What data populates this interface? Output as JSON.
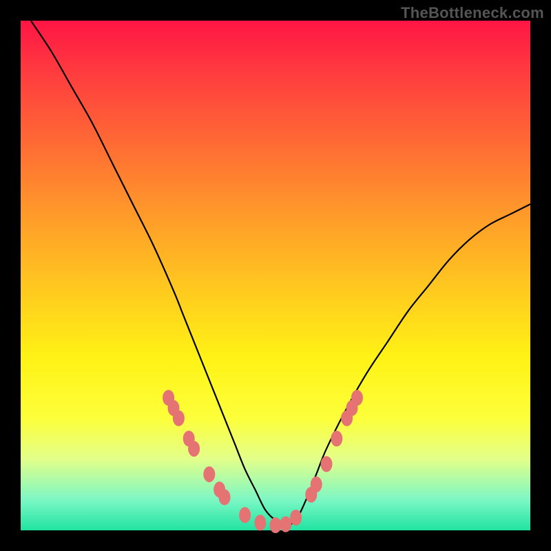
{
  "watermark": "TheBottleneck.com",
  "chart_data": {
    "type": "line",
    "title": "",
    "xlabel": "",
    "ylabel": "",
    "xlim": [
      0,
      100
    ],
    "ylim": [
      0,
      100
    ],
    "series": [
      {
        "name": "curve",
        "x": [
          2,
          6,
          10,
          14,
          18,
          22,
          26,
          30,
          32,
          34,
          36,
          38,
          40,
          42,
          44,
          46,
          48,
          50,
          52,
          54,
          56,
          58,
          60,
          64,
          68,
          72,
          76,
          80,
          84,
          88,
          92,
          96,
          100
        ],
        "y": [
          100,
          94,
          87,
          80,
          72,
          64,
          56,
          47,
          42,
          37,
          32,
          27,
          22,
          17,
          12,
          8,
          4,
          2,
          1,
          2,
          6,
          11,
          16,
          24,
          31,
          37,
          43,
          48,
          53,
          57,
          60,
          62,
          64
        ]
      }
    ],
    "markers": [
      {
        "x": 29,
        "y": 26
      },
      {
        "x": 30,
        "y": 24
      },
      {
        "x": 31,
        "y": 22
      },
      {
        "x": 33,
        "y": 18
      },
      {
        "x": 34,
        "y": 16
      },
      {
        "x": 37,
        "y": 11
      },
      {
        "x": 39,
        "y": 8
      },
      {
        "x": 40,
        "y": 6.5
      },
      {
        "x": 44,
        "y": 3
      },
      {
        "x": 47,
        "y": 1.5
      },
      {
        "x": 50,
        "y": 1
      },
      {
        "x": 52,
        "y": 1.2
      },
      {
        "x": 54,
        "y": 2.5
      },
      {
        "x": 57,
        "y": 7
      },
      {
        "x": 58,
        "y": 9
      },
      {
        "x": 60,
        "y": 13
      },
      {
        "x": 62,
        "y": 18
      },
      {
        "x": 64,
        "y": 22
      },
      {
        "x": 65,
        "y": 24
      },
      {
        "x": 66,
        "y": 26
      }
    ]
  }
}
